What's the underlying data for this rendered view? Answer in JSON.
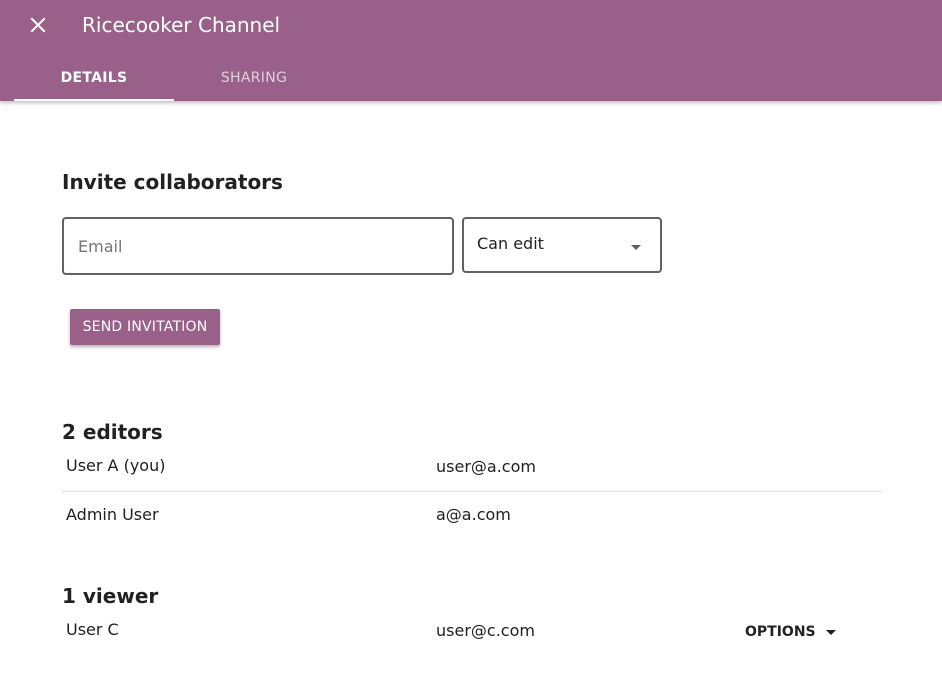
{
  "header": {
    "title": "Ricecooker Channel",
    "close_icon": "close-icon",
    "tabs": [
      {
        "label": "DETAILS",
        "active": true
      },
      {
        "label": "SHARING",
        "active": false
      }
    ],
    "background_color": "#996189"
  },
  "invite": {
    "title": "Invite collaborators",
    "email_placeholder": "Email",
    "email_value": "",
    "permission_value": "Can edit",
    "send_label": "SEND INVITATION"
  },
  "editors": {
    "title": "2 editors",
    "rows": [
      {
        "name": "User A (you)",
        "email": "user@a.com"
      },
      {
        "name": "Admin User",
        "email": "a@a.com"
      }
    ]
  },
  "viewers": {
    "title": "1 viewer",
    "rows": [
      {
        "name": "User C",
        "email": "user@c.com",
        "options_label": "OPTIONS"
      }
    ]
  }
}
